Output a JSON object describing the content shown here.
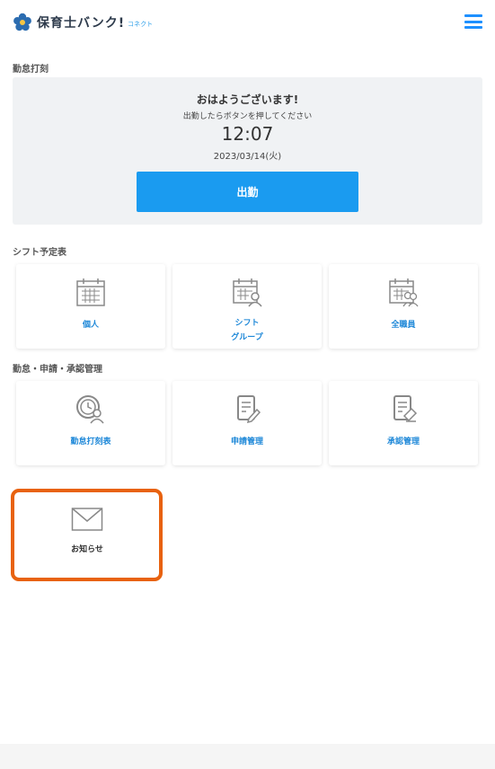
{
  "header": {
    "app_name": "保育士バンク!",
    "app_sub": "コネクト",
    "menu_icon": "hamburger-menu-icon",
    "brand_color": "#1e90ff"
  },
  "attendance": {
    "section_title": "勤怠打刻",
    "greeting": "おはようございます!",
    "hint": "出勤したらボタンを押してください",
    "time": "12:07",
    "date": "2023/03/14(火)",
    "punch_label": "出勤",
    "button_color": "#1a9bf0"
  },
  "shift": {
    "section_title": "シフト予定表",
    "cards": [
      {
        "label": "個人",
        "icon": "calendar-icon"
      },
      {
        "label": "シフト\nグループ",
        "icon": "calendar-group-icon"
      },
      {
        "label": "全職員",
        "icon": "calendar-all-staff-icon"
      }
    ]
  },
  "management": {
    "section_title": "勤怠・申請・承認管理",
    "cards": [
      {
        "label": "勤怠打刻表",
        "icon": "attendance-clock-icon"
      },
      {
        "label": "申請管理",
        "icon": "application-edit-icon"
      },
      {
        "label": "承認管理",
        "icon": "approval-document-icon"
      }
    ]
  },
  "notice": {
    "label": "お知らせ",
    "icon": "envelope-icon",
    "highlight_color": "#e8620f"
  }
}
